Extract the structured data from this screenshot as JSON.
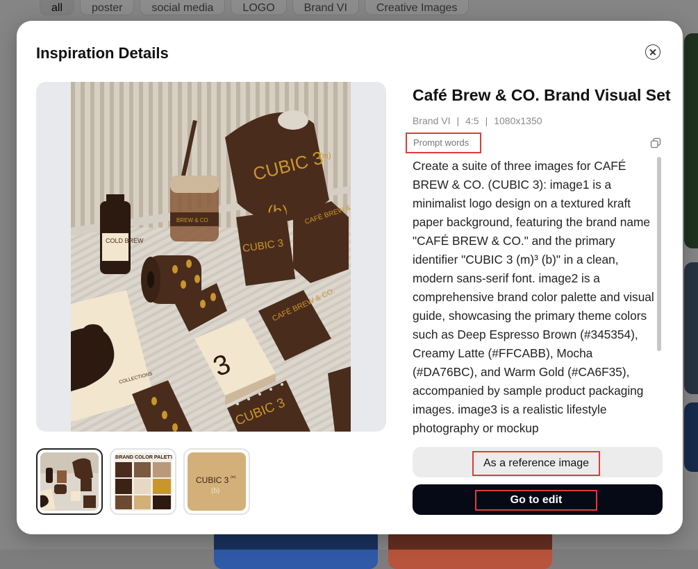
{
  "background": {
    "category_tabs": [
      "all",
      "poster",
      "social media",
      "LOGO",
      "Brand VI",
      "Creative Images"
    ],
    "active_tab": "all"
  },
  "modal": {
    "title": "Inspiration Details",
    "close_icon": "close-circle-icon"
  },
  "detail": {
    "title": "Café Brew & CO. Brand Visual Set",
    "meta": {
      "category": "Brand VI",
      "separator": "|",
      "ratio": "4:5",
      "size": "1080x1350"
    },
    "prompt_label": "Prompt words",
    "copy_icon": "copy-icon",
    "prompt_text": "Create a suite of three images for CAFÉ BREW & CO. (CUBIC 3): image1 is a minimalist logo design on a textured kraft paper background, featuring the brand name \"CAFÉ BREW & CO.\" and the primary identifier \"CUBIC 3 (m)³ (b)\" in a clean, modern sans-serif font. image2 is a comprehensive brand color palette and visual guide, showcasing the primary theme colors such as Deep Espresso Brown (#345354), Creamy Latte (#FFCABB), Mocha (#DA76BC), and Warm Gold (#CA6F35), accompanied by sample product packaging images. image3 is a realistic lifestyle photography or mockup"
  },
  "preview": {
    "labels": {
      "cup_sleeve": "CUBIC 3",
      "cup_sup": "(m)",
      "cup_b": "(b)",
      "bottle": "COLD BREW",
      "glass": "BREW & CO",
      "box": "CAFÉ BREW & CO.",
      "bag": "CUBIC 3",
      "book": "CAFÉ BREW & CO.",
      "notebook": "CUBIC 3",
      "card_number": "3",
      "big_number": "3",
      "collections": "COLLECTIONS"
    }
  },
  "thumbnails": [
    {
      "name": "thumb-lifestyle"
    },
    {
      "name": "thumb-palette",
      "label": "BRAND COLOR PALETTE"
    },
    {
      "name": "thumb-logo",
      "label": "CUBIC 3",
      "sup": "(m)",
      "sub": "(b)"
    }
  ],
  "buttons": {
    "reference": "As a reference image",
    "edit": "Go to edit"
  },
  "colors": {
    "espresso": "#4a2c1c",
    "gold": "#c9962e",
    "cream": "#f2e6cf",
    "kraft": "#d3b07a",
    "highlight": "#e23a3a",
    "primary_button": "#060916"
  }
}
